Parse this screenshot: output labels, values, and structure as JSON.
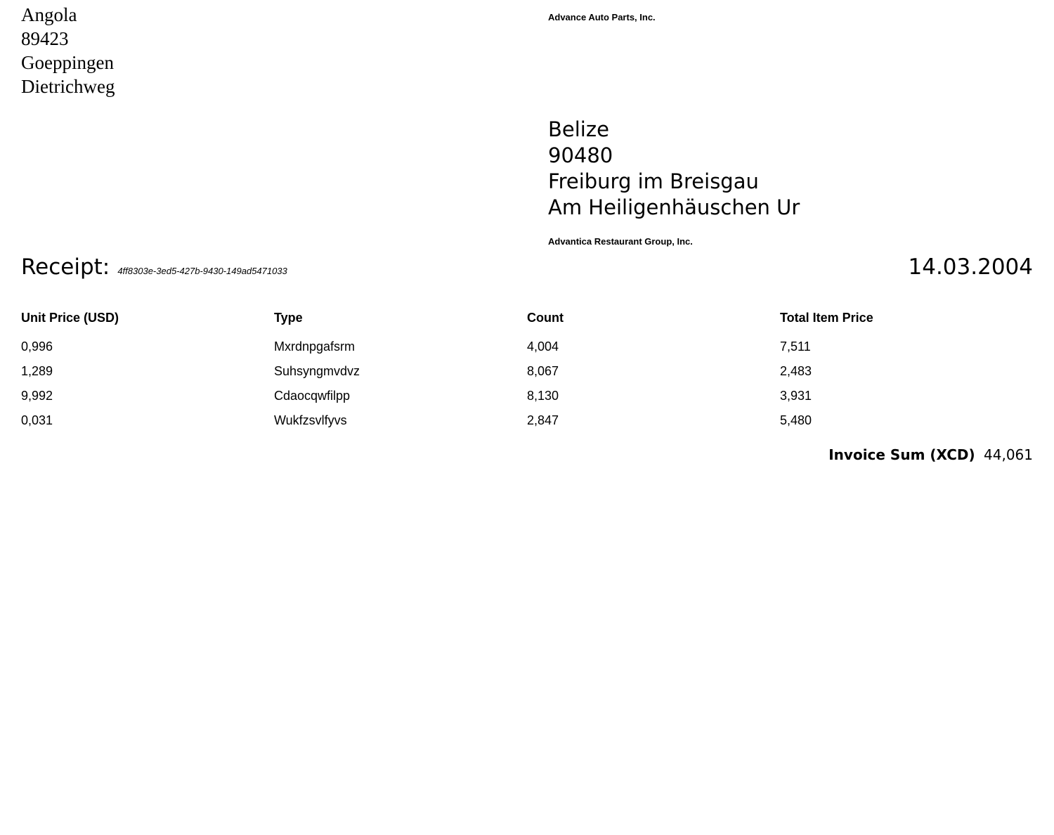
{
  "sender": {
    "address_lines": [
      "Angola",
      "89423",
      "Goeppingen",
      "Dietrichweg"
    ],
    "company": "Advance Auto Parts, Inc."
  },
  "recipient": {
    "address_lines": [
      "Belize",
      "90480",
      "Freiburg im Breisgau",
      "Am Heiligenhäuschen Ur"
    ],
    "company": "Advantica Restaurant Group, Inc."
  },
  "receipt": {
    "label": "Receipt:",
    "id": "4ff8303e-3ed5-427b-9430-149ad5471033",
    "date": "14.03.2004"
  },
  "table": {
    "headers": [
      "Unit Price (USD)",
      "Type",
      "Count",
      "Total Item Price"
    ],
    "rows": [
      [
        "0,996",
        "Mxrdnpgafsrm",
        "4,004",
        "7,511"
      ],
      [
        "1,289",
        "Suhsyngmvdvz",
        "8,067",
        "2,483"
      ],
      [
        "9,992",
        "Cdaocqwfilpp",
        "8,130",
        "3,931"
      ],
      [
        "0,031",
        "Wukfzsvlfyvs",
        "2,847",
        "5,480"
      ]
    ]
  },
  "summary": {
    "label": "Invoice Sum (XCD)",
    "value": "44,061"
  }
}
